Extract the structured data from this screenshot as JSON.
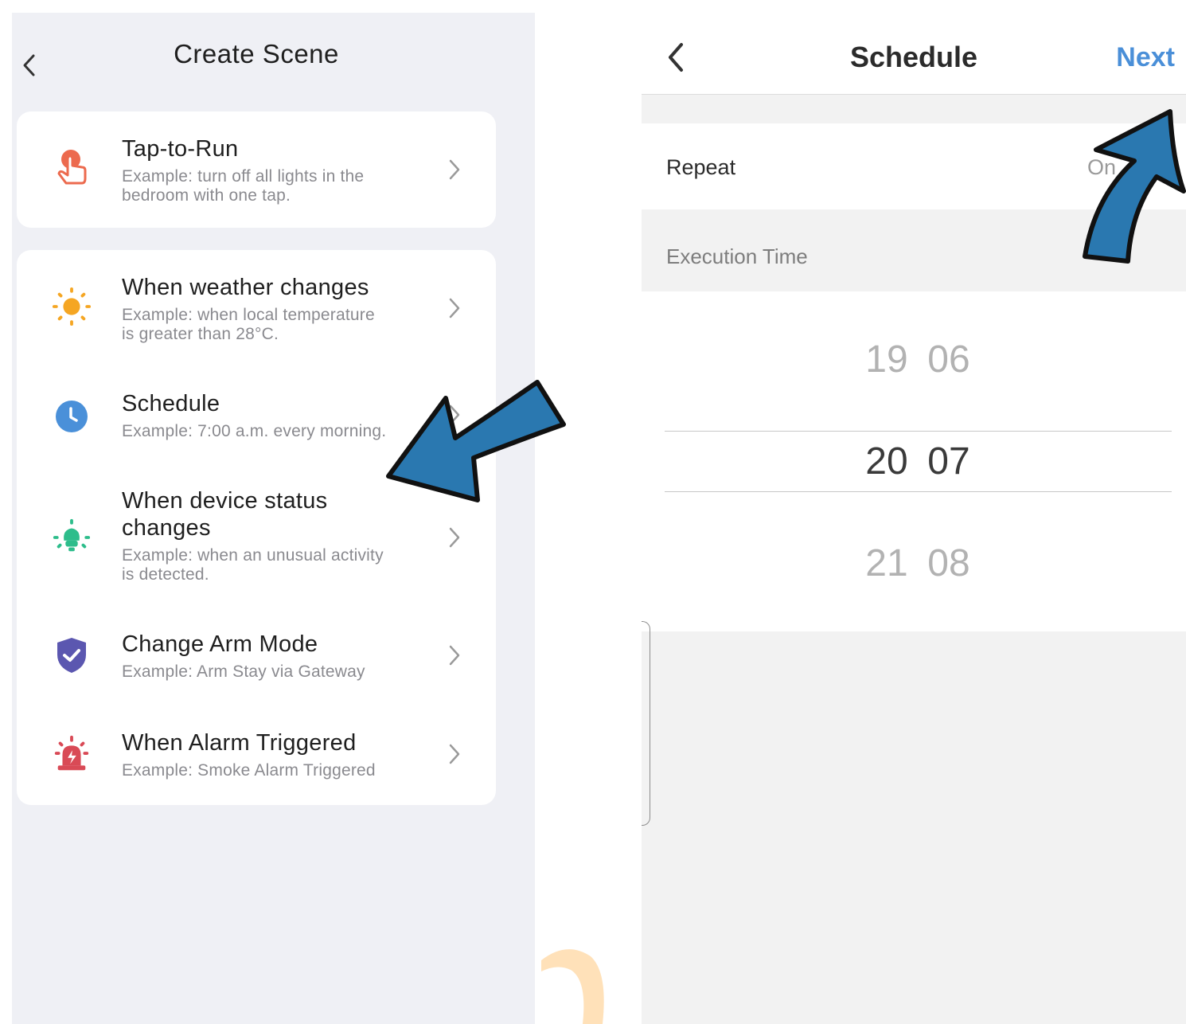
{
  "left_screen": {
    "title": "Create Scene",
    "icons": {
      "back": "chevron-left-icon"
    },
    "items": [
      {
        "icon": "tap-hand-icon",
        "color": "#ec6a4e",
        "title": "Tap-to-Run",
        "desc_line1": "Example: turn off all lights in the",
        "desc_line2": "bedroom with one tap."
      },
      {
        "icon": "sun-icon",
        "color": "#f5a623",
        "title": "When weather changes",
        "desc_line1": "Example: when local temperature",
        "desc_line2": "is greater than 28°C."
      },
      {
        "icon": "clock-icon",
        "color": "#4a90d9",
        "title": "Schedule",
        "desc_line1": "Example: 7:00 a.m. every morning."
      },
      {
        "icon": "bulb-icon",
        "color": "#2dbd8b",
        "title_line1": "When device status",
        "title_line2": "changes",
        "desc_line1": "Example: when an unusual activity",
        "desc_line2": "is detected."
      },
      {
        "icon": "shield-check-icon",
        "color": "#5b57b0",
        "title": "Change Arm Mode",
        "desc_line1": "Example: Arm Stay via Gateway"
      },
      {
        "icon": "alarm-siren-icon",
        "color": "#d94a56",
        "title": "When Alarm Triggered",
        "desc_line1": "Example: Smoke Alarm Triggered"
      }
    ]
  },
  "right_screen": {
    "title": "Schedule",
    "next_label": "Next",
    "repeat_label": "Repeat",
    "repeat_value": "On",
    "execution_time_label": "Execution Time",
    "picker": {
      "hours": [
        "19",
        "20",
        "21"
      ],
      "minutes": [
        "06",
        "07",
        "08"
      ],
      "selected_hour": "20",
      "selected_minute": "07"
    },
    "accent_color": "#4a8fd8"
  },
  "annotations": {
    "arrow_color": "#2a78b0"
  }
}
